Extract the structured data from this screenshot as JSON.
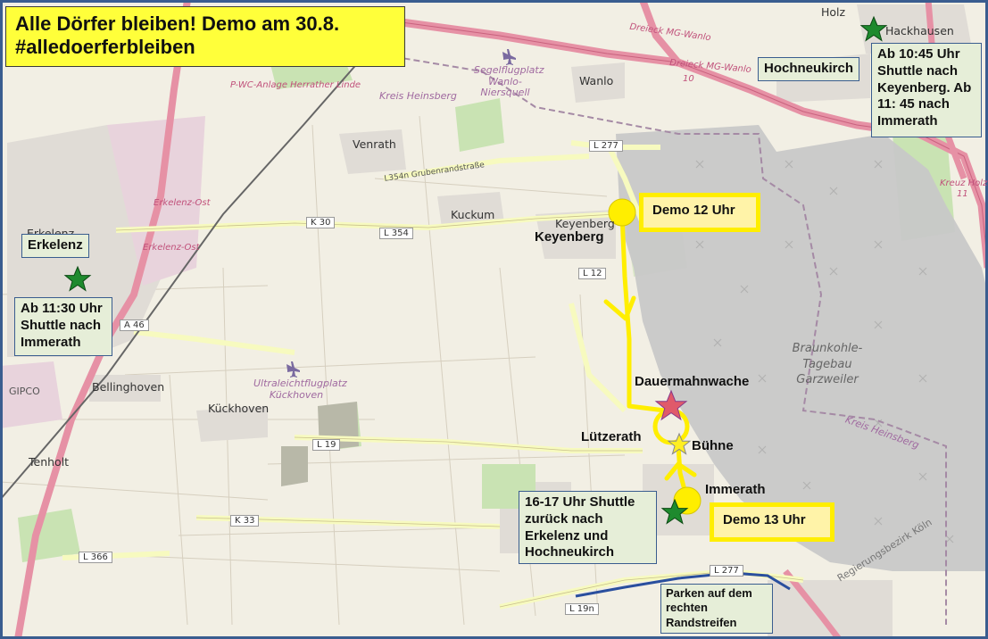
{
  "title": {
    "line1": "Alle Dörfer bleiben! Demo am 30.8.",
    "line2": "#alledoerferbleiben"
  },
  "colors": {
    "route": "#ffee00",
    "star_shuttle": "#1e8a2e",
    "star_camp": "#e05a6a",
    "star_stage": "#ffee22",
    "parking_line": "#2a4f9e",
    "mine_area": "#c8c8c8",
    "map_base": "#f2efe4",
    "frame": "#3a5d8f"
  },
  "icons": [
    "star-icon",
    "circle-marker-icon",
    "arrow-icon",
    "airfield-icon"
  ],
  "annotations": {
    "erkelenz_label": "Erkelenz",
    "erkelenz_shuttle": "Ab 11:30 Uhr Shuttle nach Immerath",
    "hochneukirch_label": "Hochneukirch",
    "hochneukirch_shuttle": "Ab 10:45 Uhr Shuttle nach Keyenberg. Ab 11: 45 nach Immerath",
    "demo12": "Demo 12 Uhr",
    "demo13": "Demo 13 Uhr",
    "keyenberg": "Keyenberg",
    "dauermahnwache": "Dauermahnwache",
    "luetzerath": "Lützerath",
    "buehne": "Bühne",
    "immerath": "Immerath",
    "return_shuttle": "16-17 Uhr Shuttle zurück nach Erkelenz und Hochneukirch",
    "parking": "Parken auf dem rechten Randstreifen"
  },
  "map_labels": {
    "holz": "Holz",
    "hackhausen": "Hackhausen",
    "wanlo": "Wanlo",
    "venrath": "Venrath",
    "kuckum": "Kuckum",
    "keyenberg_small": "Keyenberg",
    "bellinghoven": "Bellinghoven",
    "kueckhoven": "Kückhoven",
    "tenholt": "Tenholt",
    "gipco": "GIPCO",
    "erkelenz_small": "Erkelenz",
    "dreieck1": "Dreieck MG-Wanlo",
    "dreieck2": "Dreieck MG-Wanlo",
    "dreieck_num": "10",
    "segelflug": "Segelflugplatz Wanlo-Niersquell",
    "ultraleicht": "Ultraleichtflugplatz Kückhoven",
    "kreis1": "Kreis Heinsberg",
    "kreis2": "Kreis Heinsberg",
    "pwc": "P-WC-Anlage Herrather Linde",
    "grubenrand": "L354n Grubenrandstraße",
    "erkelenz_ost1": "Erkelenz-Ost",
    "erkelenz_ost2": "Erkelenz-Ost",
    "kreuz_holz": "Kreuz Holz",
    "kreuz_num": "11",
    "mine": "Braunkohle-Tagebau Garzweiler",
    "regbez": "Regierungsbezirk Köln"
  },
  "roads": [
    "L 277",
    "K 30",
    "L 354",
    "L 12",
    "A 46",
    "L 19",
    "K 33",
    "L 366",
    "L 19n",
    "L 277"
  ]
}
